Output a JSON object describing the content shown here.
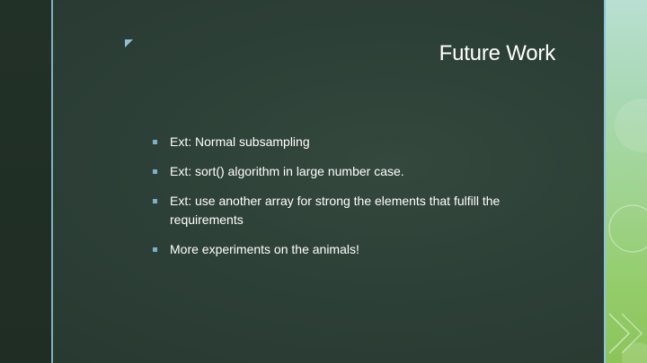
{
  "slide": {
    "title": "Future Work",
    "bullets": [
      {
        "text": "Ext: Normal subsampling"
      },
      {
        "text": "Ext: sort() algorithm in large number case."
      },
      {
        "text": "Ext: use another array for strong the elements that fulfill the requirements"
      },
      {
        "text": "More experiments on the animals!"
      }
    ]
  },
  "theme": {
    "background": "#2d4037",
    "accent_line": "#7fb0c6",
    "decor_green": "#93cc6a",
    "text": "#ffffff"
  },
  "icons": {
    "corner": "corner-triangle-icon",
    "bullet": "square-bullet-icon"
  }
}
